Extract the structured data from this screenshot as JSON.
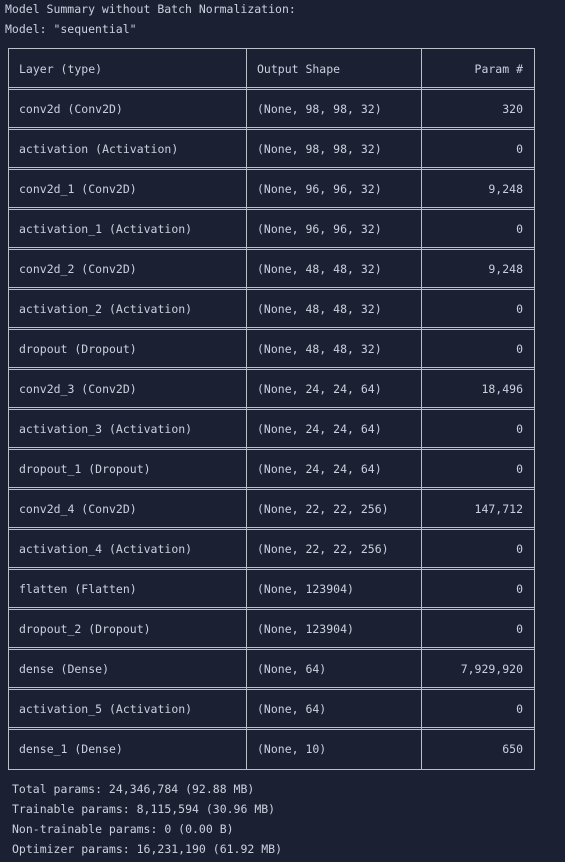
{
  "header": {
    "title": "Model Summary without Batch Normalization:",
    "model_line": "Model: \"sequential\""
  },
  "table": {
    "columns": [
      "Layer (type)",
      "Output Shape",
      "Param #"
    ],
    "rows": [
      {
        "layer": "conv2d (Conv2D)",
        "shape": "(None, 98, 98, 32)",
        "params": "320"
      },
      {
        "layer": "activation (Activation)",
        "shape": "(None, 98, 98, 32)",
        "params": "0"
      },
      {
        "layer": "conv2d_1 (Conv2D)",
        "shape": "(None, 96, 96, 32)",
        "params": "9,248"
      },
      {
        "layer": "activation_1 (Activation)",
        "shape": "(None, 96, 96, 32)",
        "params": "0"
      },
      {
        "layer": "conv2d_2 (Conv2D)",
        "shape": "(None, 48, 48, 32)",
        "params": "9,248"
      },
      {
        "layer": "activation_2 (Activation)",
        "shape": "(None, 48, 48, 32)",
        "params": "0"
      },
      {
        "layer": "dropout (Dropout)",
        "shape": "(None, 48, 48, 32)",
        "params": "0"
      },
      {
        "layer": "conv2d_3 (Conv2D)",
        "shape": "(None, 24, 24, 64)",
        "params": "18,496"
      },
      {
        "layer": "activation_3 (Activation)",
        "shape": "(None, 24, 24, 64)",
        "params": "0"
      },
      {
        "layer": "dropout_1 (Dropout)",
        "shape": "(None, 24, 24, 64)",
        "params": "0"
      },
      {
        "layer": "conv2d_4 (Conv2D)",
        "shape": "(None, 22, 22, 256)",
        "params": "147,712"
      },
      {
        "layer": "activation_4 (Activation)",
        "shape": "(None, 22, 22, 256)",
        "params": "0"
      },
      {
        "layer": "flatten (Flatten)",
        "shape": "(None, 123904)",
        "params": "0"
      },
      {
        "layer": "dropout_2 (Dropout)",
        "shape": "(None, 123904)",
        "params": "0"
      },
      {
        "layer": "dense (Dense)",
        "shape": "(None, 64)",
        "params": "7,929,920"
      },
      {
        "layer": "activation_5 (Activation)",
        "shape": "(None, 64)",
        "params": "0"
      },
      {
        "layer": "dense_1 (Dense)",
        "shape": "(None, 10)",
        "params": "650"
      }
    ]
  },
  "summary": {
    "total": "Total params: 24,346,784 (92.88 MB)",
    "trainable": "Trainable params: 8,115,594 (30.96 MB)",
    "non_trainable": "Non-trainable params: 0 (0.00 B)",
    "optimizer": "Optimizer params: 16,231,190 (61.92 MB)"
  },
  "colors": {
    "background": "#1b2133",
    "text": "#c9d1de",
    "border": "#b9c0cc"
  }
}
